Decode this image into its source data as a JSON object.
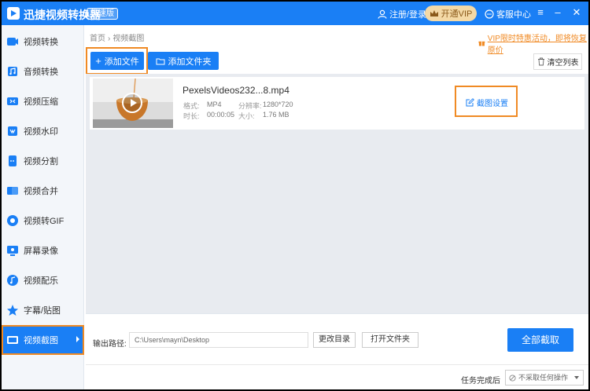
{
  "app": {
    "title": "迅捷视频转换器",
    "edition": "极速版",
    "login": "注册/登录",
    "vip": "开通VIP",
    "service": "客服中心"
  },
  "colors": {
    "primary": "#1a7ff5",
    "highlight": "#f08a24",
    "vip_bg": "#f4d9a6"
  },
  "sidebar": {
    "items": [
      {
        "label": "视频转换",
        "icon": "video-convert-icon"
      },
      {
        "label": "音频转换",
        "icon": "audio-convert-icon"
      },
      {
        "label": "视频压缩",
        "icon": "video-compress-icon"
      },
      {
        "label": "视频水印",
        "icon": "video-watermark-icon"
      },
      {
        "label": "视频分割",
        "icon": "video-split-icon"
      },
      {
        "label": "视频合并",
        "icon": "video-merge-icon"
      },
      {
        "label": "视频转GIF",
        "icon": "video-gif-icon"
      },
      {
        "label": "屏幕录像",
        "icon": "screen-record-icon"
      },
      {
        "label": "视频配乐",
        "icon": "video-music-icon"
      },
      {
        "label": "字幕/贴图",
        "icon": "subtitle-sticker-icon"
      },
      {
        "label": "视频截图",
        "icon": "video-screenshot-icon",
        "active": true
      }
    ]
  },
  "breadcrumb": {
    "home": "首页",
    "sep": "›",
    "current": "视频截图"
  },
  "promo": {
    "text": "VIP限时特惠活动，即将恢复原价"
  },
  "toolbar": {
    "add_file": "添加文件",
    "add_folder": "添加文件夹",
    "clear_list": "清空列表"
  },
  "file": {
    "name": "PexelsVideos232...8.mp4",
    "format_label": "格式:",
    "format": "MP4",
    "resolution_label": "分辨率:",
    "resolution": "1280*720",
    "duration_label": "时长:",
    "duration": "00:00:05",
    "size_label": "大小:",
    "size": "1.76 MB",
    "settings": "截图设置"
  },
  "output": {
    "label": "输出路径:",
    "path": "C:\\Users\\mayn\\Desktop",
    "change_dir": "更改目录",
    "open_folder": "打开文件夹",
    "capture_all": "全部截取"
  },
  "status": {
    "after_label": "任务完成后",
    "after_value": "不采取任何操作"
  }
}
